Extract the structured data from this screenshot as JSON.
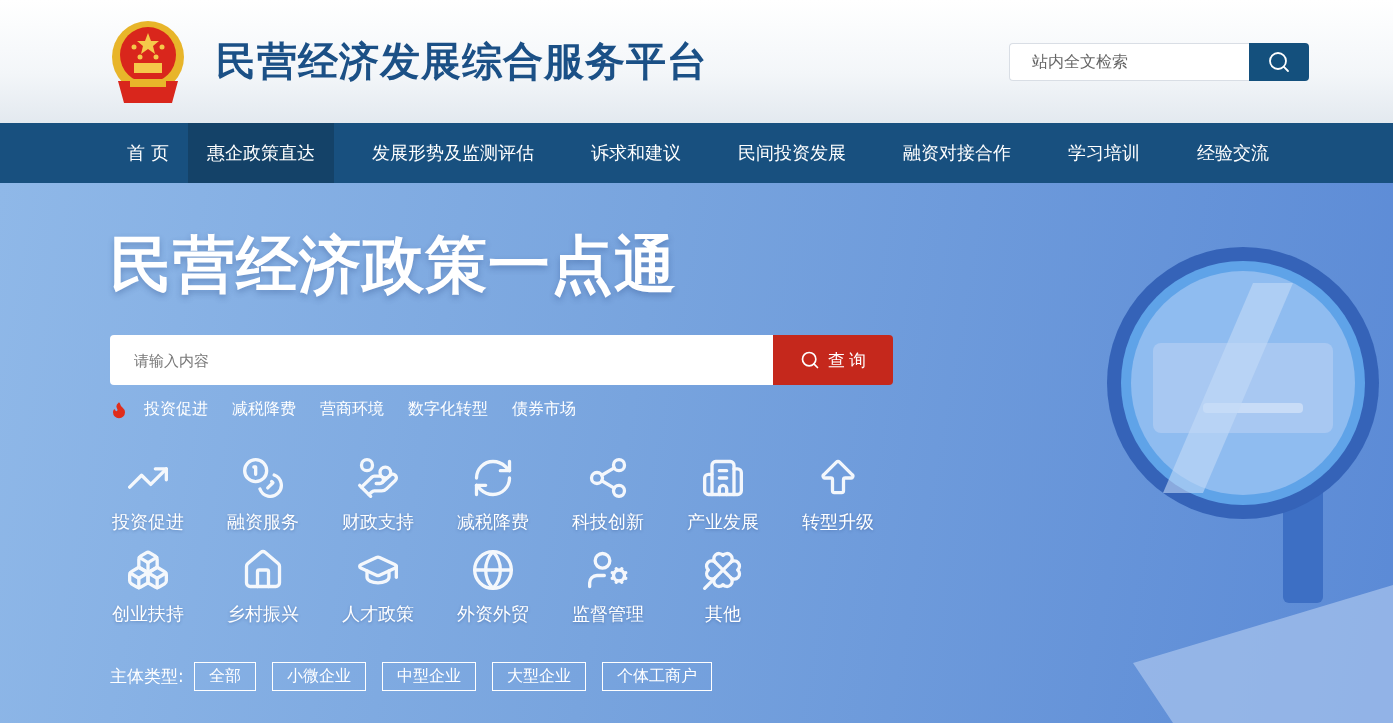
{
  "header": {
    "title": "民营经济发展综合服务平台",
    "search": {
      "placeholder": "站内全文检索"
    }
  },
  "nav": [
    {
      "label": "首 页",
      "selected": false
    },
    {
      "label": "惠企政策直达",
      "selected": true
    },
    {
      "label": "发展形势及监测评估",
      "selected": false
    },
    {
      "label": "诉求和建议",
      "selected": false
    },
    {
      "label": "民间投资发展",
      "selected": false
    },
    {
      "label": "融资对接合作",
      "selected": false
    },
    {
      "label": "学习培训",
      "selected": false
    },
    {
      "label": "经验交流",
      "selected": false
    }
  ],
  "hero": {
    "title": "民营经济政策一点通",
    "search": {
      "placeholder": "请输入内容",
      "button": "查 询"
    },
    "hot_tags": [
      "投资促进",
      "减税降费",
      "营商环境",
      "数字化转型",
      "债券市场"
    ],
    "categories": [
      "投资促进",
      "融资服务",
      "财政支持",
      "减税降费",
      "科技创新",
      "产业发展",
      "转型升级",
      "创业扶持",
      "乡村振兴",
      "人才政策",
      "外资外贸",
      "监督管理",
      "其他"
    ],
    "subject_type": {
      "label": "主体类型:",
      "options": [
        "全部",
        "小微企业",
        "中型企业",
        "大型企业",
        "个体工商户"
      ]
    }
  }
}
